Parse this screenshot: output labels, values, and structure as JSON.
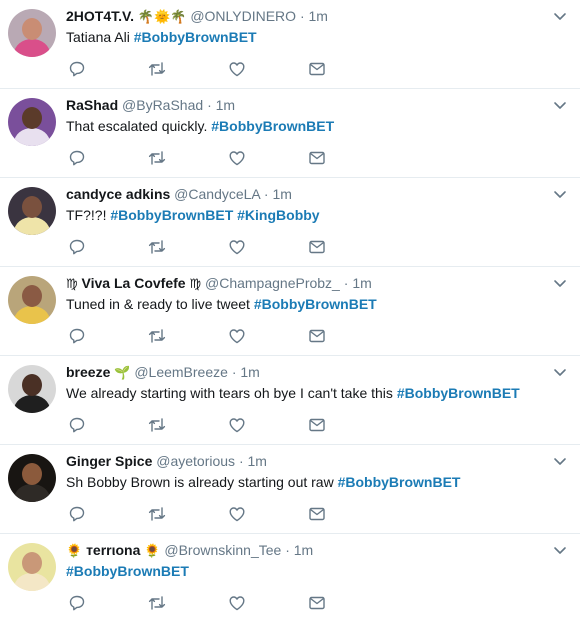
{
  "tweets": [
    {
      "name": "2HOT4T.V.",
      "name_suffix": "🌴🌞🌴",
      "handle": "@ONLYDINERO",
      "time": "1m",
      "text_plain": "Tatiana Ali",
      "hashtags": [
        "#BobbyBrownBET"
      ],
      "avatar": {
        "bg": "#b9a9b4",
        "skin": "#c98d74",
        "shirt": "#d94f8a"
      }
    },
    {
      "name": "RaShad",
      "handle": "@ByRaShad",
      "time": "1m",
      "text_plain": "That escalated quickly.",
      "hashtags": [
        "#BobbyBrownBET"
      ],
      "avatar": {
        "bg": "#7a4f9b",
        "skin": "#5b3b2a",
        "shirt": "#e8e0ef"
      }
    },
    {
      "name": "candyce adkins",
      "handle": "@CandyceLA",
      "time": "1m",
      "text_plain": "TF?!?!",
      "hashtags": [
        "#BobbyBrownBET",
        "#KingBobby"
      ],
      "avatar": {
        "bg": "#3a3440",
        "skin": "#7a513e",
        "shirt": "#efe4a9"
      }
    },
    {
      "name_prefix": "♍",
      "name": "Viva La Covfefe",
      "name_suffix": "♍",
      "handle": "@ChampagneProbz_",
      "time": "1m",
      "text_plain": "Tuned in & ready to live tweet",
      "hashtags": [
        "#BobbyBrownBET"
      ],
      "avatar": {
        "bg": "#b9a57a",
        "skin": "#8a5a44",
        "shirt": "#e9c34b"
      }
    },
    {
      "name": "breeze",
      "name_suffix": "🌱",
      "handle": "@LeemBreeze",
      "time": "1m",
      "text_plain": "We already starting with tears oh bye I can't take this",
      "hashtags": [
        "#BobbyBrownBET"
      ],
      "avatar": {
        "bg": "#d8d8d8",
        "skin": "#4a3025",
        "shirt": "#1f1f1f"
      }
    },
    {
      "name": "Ginger Spice",
      "handle": "@ayetorious",
      "time": "1m",
      "text_plain": "Sh   Bobby Brown is already starting out raw",
      "hashtags": [
        "#BobbyBrownBET"
      ],
      "avatar": {
        "bg": "#181512",
        "skin": "#8b5a3c",
        "shirt": "#2e2a26"
      }
    },
    {
      "name_prefix": "🌻",
      "name": "тerrιona",
      "name_suffix": "🌻",
      "handle": "@Brownskinn_Tee",
      "time": "1m",
      "text_plain": "",
      "hashtags": [
        "#BobbyBrownBET"
      ],
      "avatar": {
        "bg": "#e9e4a0",
        "skin": "#c99878",
        "shirt": "#f4e7c6"
      }
    }
  ],
  "dot": "·",
  "actions": [
    "reply-icon",
    "retweet-icon",
    "like-icon",
    "message-icon"
  ],
  "colors": {
    "hashtag": "#1b7bb5",
    "secondary": "#657786",
    "divider": "#e6ecf0"
  }
}
